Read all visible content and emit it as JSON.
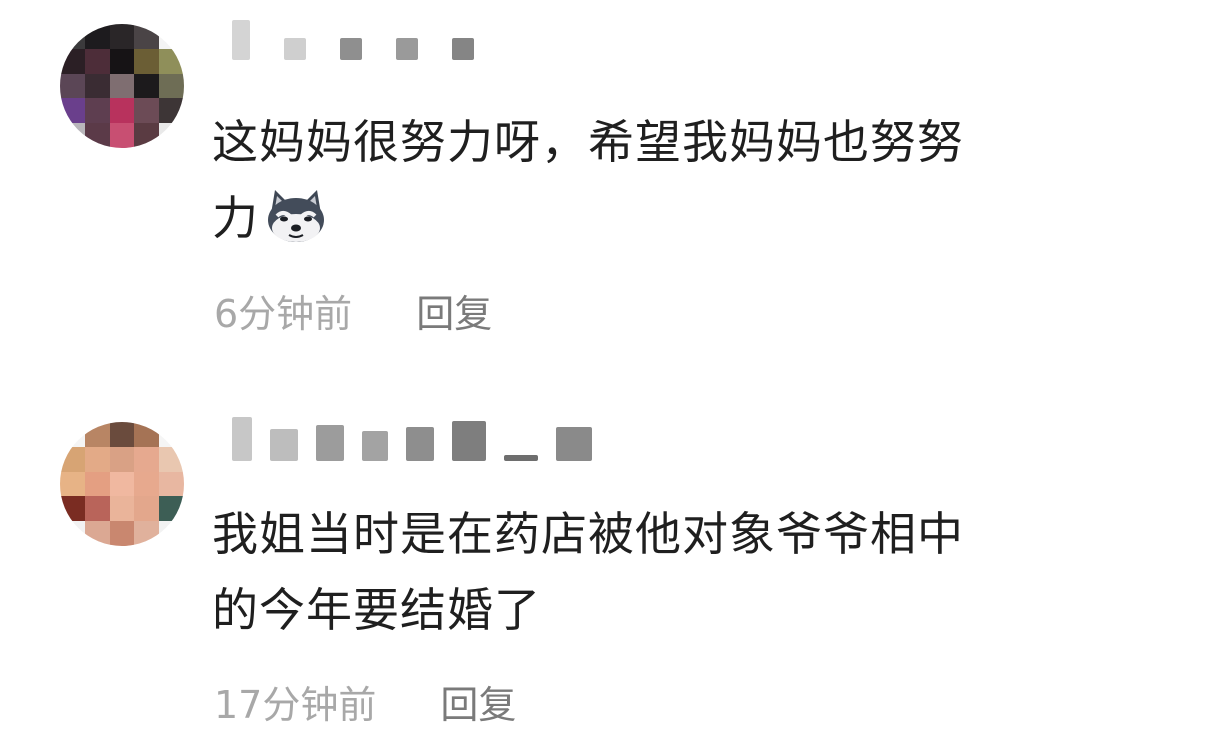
{
  "comments": [
    {
      "text_lines": [
        "这妈妈很努力呀，希望我妈妈也努努",
        "力"
      ],
      "emoji": "husky-dog-face-icon",
      "timestamp": "6分钟前",
      "reply_label": "回复"
    },
    {
      "text_lines": [
        "我姐当时是在药店被他对象爷爷相中",
        "的今年要结婚了"
      ],
      "timestamp": "17分钟前",
      "reply_label": "回复"
    }
  ],
  "colors": {
    "text": "#1f1f1f",
    "meta": "#a8a8a8",
    "reply": "#7a7a7a",
    "background": "#ffffff"
  }
}
